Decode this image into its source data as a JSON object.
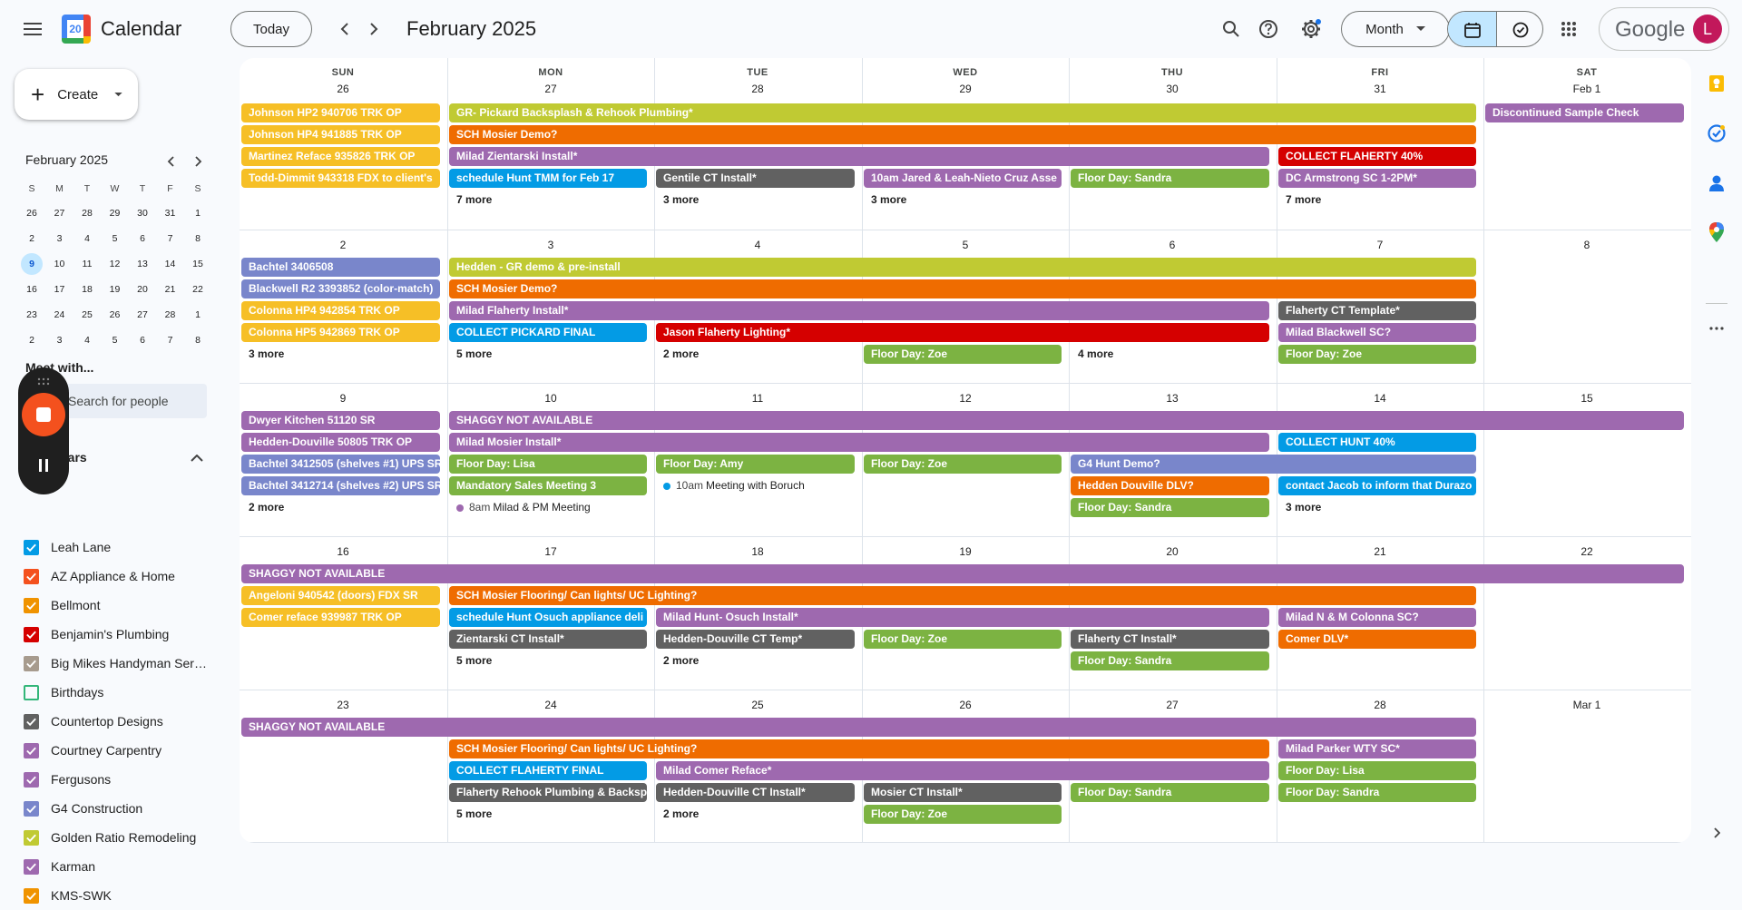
{
  "app": {
    "title": "Calendar",
    "logo_day": "20",
    "logo_colors": {
      "blue": "#4285f4",
      "red": "#ea4335",
      "yellow": "#fbbc04",
      "green": "#34a853"
    }
  },
  "header": {
    "today_label": "Today",
    "month_title": "February 2025",
    "view_label": "Month",
    "google_label": "Google",
    "avatar_letter": "L",
    "avatar_color": "#c2185b"
  },
  "sidebar": {
    "create_label": "Create",
    "mini_title": "February 2025",
    "mini_dow": [
      "S",
      "M",
      "T",
      "W",
      "T",
      "F",
      "S"
    ],
    "mini_weeks": [
      [
        "26",
        "27",
        "28",
        "29",
        "30",
        "31",
        "1"
      ],
      [
        "2",
        "3",
        "4",
        "5",
        "6",
        "7",
        "8"
      ],
      [
        "9",
        "10",
        "11",
        "12",
        "13",
        "14",
        "15"
      ],
      [
        "16",
        "17",
        "18",
        "19",
        "20",
        "21",
        "22"
      ],
      [
        "23",
        "24",
        "25",
        "26",
        "27",
        "28",
        "1"
      ],
      [
        "2",
        "3",
        "4",
        "5",
        "6",
        "7",
        "8"
      ]
    ],
    "mini_today": "9",
    "meet_title": "Meet with...",
    "search_people_placeholder": "Search for people",
    "calendars_title": "Calendars",
    "calendars": [
      {
        "name": "Leah Lane",
        "color": "#039be5",
        "checked": true
      },
      {
        "name": "AZ Appliance & Home",
        "color": "#f4511e",
        "checked": true
      },
      {
        "name": "Bellmont",
        "color": "#f09300",
        "checked": true
      },
      {
        "name": "Benjamin's Plumbing",
        "color": "#d50000",
        "checked": true
      },
      {
        "name": "Big Mikes Handyman Serv...",
        "color": "#a79b8e",
        "checked": true
      },
      {
        "name": "Birthdays",
        "color": "#33b679",
        "checked": false
      },
      {
        "name": "Countertop Designs",
        "color": "#616161",
        "checked": true
      },
      {
        "name": "Courtney Carpentry",
        "color": "#9e69af",
        "checked": true
      },
      {
        "name": "Fergusons",
        "color": "#9e69af",
        "checked": true
      },
      {
        "name": "G4 Construction",
        "color": "#7986cb",
        "checked": true
      },
      {
        "name": "Golden Ratio Remodeling",
        "color": "#c0ca33",
        "checked": true
      },
      {
        "name": "Karman",
        "color": "#9e69af",
        "checked": true
      },
      {
        "name": "KMS-SWK",
        "color": "#f09300",
        "checked": true
      }
    ]
  },
  "grid": {
    "dow": [
      "SUN",
      "MON",
      "TUE",
      "WED",
      "THU",
      "FRI",
      "SAT"
    ],
    "weeks": [
      {
        "dates": [
          "26",
          "27",
          "28",
          "29",
          "30",
          "31",
          "Feb 1"
        ],
        "events": [
          {
            "col": 0,
            "span": 1,
            "row": 0,
            "text": "Johnson HP2 940706 TRK OP",
            "color": "#f6bf26"
          },
          {
            "col": 1,
            "span": 5,
            "row": 0,
            "text": "GR- Pickard Backsplash & Rehook Plumbing*",
            "color": "#c0ca33"
          },
          {
            "col": 6,
            "span": 1,
            "row": 0,
            "text": "Discontinued Sample Check",
            "color": "#9e69af"
          },
          {
            "col": 0,
            "span": 1,
            "row": 1,
            "text": "Johnson HP4 941885 TRK OP",
            "color": "#f6bf26"
          },
          {
            "col": 1,
            "span": 5,
            "row": 1,
            "text": "SCH Mosier Demo?",
            "color": "#ef6c00"
          },
          {
            "col": 0,
            "span": 1,
            "row": 2,
            "text": "Martinez Reface 935826 TRK OP",
            "color": "#f6bf26"
          },
          {
            "col": 1,
            "span": 4,
            "row": 2,
            "text": "Milad Zientarski Install*",
            "color": "#9e69af"
          },
          {
            "col": 5,
            "span": 1,
            "row": 2,
            "text": "COLLECT FLAHERTY 40%",
            "color": "#d50000"
          },
          {
            "col": 0,
            "span": 1,
            "row": 3,
            "text": "Todd-Dimmit 943318 FDX to client's",
            "color": "#f6bf26"
          },
          {
            "col": 1,
            "span": 1,
            "row": 3,
            "text": "schedule Hunt TMM for Feb 17",
            "color": "#039be5"
          },
          {
            "col": 2,
            "span": 1,
            "row": 3,
            "text": "Gentile CT Install*",
            "color": "#616161"
          },
          {
            "col": 3,
            "span": 1,
            "row": 3,
            "text": "10am Jared & Leah-Nieto Cruz Asse",
            "color": "#9e69af"
          },
          {
            "col": 4,
            "span": 1,
            "row": 3,
            "text": "Floor Day: Sandra",
            "color": "#7cb342"
          },
          {
            "col": 5,
            "span": 1,
            "row": 3,
            "text": "DC Armstrong SC 1-2PM*",
            "color": "#9e69af"
          }
        ],
        "more": [
          {
            "col": 1,
            "row": 4,
            "text": "7 more"
          },
          {
            "col": 2,
            "row": 4,
            "text": "3 more"
          },
          {
            "col": 3,
            "row": 4,
            "text": "3 more"
          },
          {
            "col": 5,
            "row": 4,
            "text": "7 more"
          }
        ]
      },
      {
        "dates": [
          "2",
          "3",
          "4",
          "5",
          "6",
          "7",
          "8"
        ],
        "events": [
          {
            "col": 0,
            "span": 1,
            "row": 0,
            "text": "Bachtel 3406508",
            "color": "#7986cb"
          },
          {
            "col": 1,
            "span": 5,
            "row": 0,
            "text": "Hedden - GR demo & pre-install",
            "color": "#c0ca33"
          },
          {
            "col": 0,
            "span": 1,
            "row": 1,
            "text": "Blackwell R2 3393852 (color-match)",
            "color": "#7986cb"
          },
          {
            "col": 1,
            "span": 5,
            "row": 1,
            "text": "SCH Mosier Demo?",
            "color": "#ef6c00"
          },
          {
            "col": 0,
            "span": 1,
            "row": 2,
            "text": "Colonna HP4 942854 TRK OP",
            "color": "#f6bf26"
          },
          {
            "col": 1,
            "span": 4,
            "row": 2,
            "text": "Milad Flaherty Install*",
            "color": "#9e69af"
          },
          {
            "col": 5,
            "span": 1,
            "row": 2,
            "text": "Flaherty CT Template*",
            "color": "#616161"
          },
          {
            "col": 0,
            "span": 1,
            "row": 3,
            "text": "Colonna HP5 942869 TRK OP",
            "color": "#f6bf26"
          },
          {
            "col": 1,
            "span": 1,
            "row": 3,
            "text": "COLLECT PICKARD FINAL",
            "color": "#039be5"
          },
          {
            "col": 2,
            "span": 3,
            "row": 3,
            "text": "Jason Flaherty Lighting*",
            "color": "#d50000"
          },
          {
            "col": 5,
            "span": 1,
            "row": 3,
            "text": "Milad Blackwell SC?",
            "color": "#9e69af"
          },
          {
            "col": 3,
            "span": 1,
            "row": 4,
            "text": "Floor Day: Zoe",
            "color": "#7cb342"
          },
          {
            "col": 5,
            "span": 1,
            "row": 4,
            "text": "Floor Day: Zoe",
            "color": "#7cb342"
          }
        ],
        "more": [
          {
            "col": 0,
            "row": 4,
            "text": "3 more"
          },
          {
            "col": 1,
            "row": 4,
            "text": "5 more"
          },
          {
            "col": 2,
            "row": 4,
            "text": "2 more"
          },
          {
            "col": 4,
            "row": 4,
            "text": "4 more"
          }
        ]
      },
      {
        "dates": [
          "9",
          "10",
          "11",
          "12",
          "13",
          "14",
          "15"
        ],
        "events": [
          {
            "col": 0,
            "span": 1,
            "row": 0,
            "text": "Dwyer Kitchen 51120 SR",
            "color": "#9e69af"
          },
          {
            "col": 1,
            "span": 6,
            "row": 0,
            "text": "SHAGGY NOT AVAILABLE",
            "color": "#9e69af"
          },
          {
            "col": 0,
            "span": 1,
            "row": 1,
            "text": "Hedden-Douville 50805 TRK OP",
            "color": "#9e69af"
          },
          {
            "col": 1,
            "span": 4,
            "row": 1,
            "text": "Milad Mosier Install*",
            "color": "#9e69af"
          },
          {
            "col": 5,
            "span": 1,
            "row": 1,
            "text": "COLLECT HUNT 40%",
            "color": "#039be5"
          },
          {
            "col": 0,
            "span": 1,
            "row": 2,
            "text": "Bachtel 3412505 (shelves #1) UPS SR",
            "color": "#7986cb"
          },
          {
            "col": 1,
            "span": 1,
            "row": 2,
            "text": "Floor Day: Lisa",
            "color": "#7cb342"
          },
          {
            "col": 2,
            "span": 1,
            "row": 2,
            "text": "Floor Day: Amy",
            "color": "#7cb342"
          },
          {
            "col": 3,
            "span": 1,
            "row": 2,
            "text": "Floor Day: Zoe",
            "color": "#7cb342"
          },
          {
            "col": 4,
            "span": 2,
            "row": 2,
            "text": "G4 Hunt Demo?",
            "color": "#7986cb"
          },
          {
            "col": 0,
            "span": 1,
            "row": 3,
            "text": "Bachtel 3412714 (shelves #2) UPS SR",
            "color": "#7986cb"
          },
          {
            "col": 1,
            "span": 1,
            "row": 3,
            "text": "Mandatory Sales Meeting 3",
            "color": "#7cb342"
          },
          {
            "col": 4,
            "span": 1,
            "row": 3,
            "text": "Hedden Douville DLV?",
            "color": "#ef6c00"
          },
          {
            "col": 5,
            "span": 1,
            "row": 3,
            "text": "contact Jacob to inform that Durazo",
            "color": "#039be5"
          },
          {
            "col": 4,
            "span": 1,
            "row": 4,
            "text": "Floor Day: Sandra",
            "color": "#7cb342"
          }
        ],
        "dots": [
          {
            "col": 2,
            "row": 3,
            "time": "10am",
            "text": "Meeting with Boruch",
            "color": "#039be5"
          },
          {
            "col": 1,
            "row": 4,
            "time": "8am",
            "text": "Milad & PM Meeting",
            "color": "#9e69af"
          }
        ],
        "more": [
          {
            "col": 0,
            "row": 4,
            "text": "2 more"
          },
          {
            "col": 5,
            "row": 4,
            "text": "3 more"
          }
        ]
      },
      {
        "dates": [
          "16",
          "17",
          "18",
          "19",
          "20",
          "21",
          "22"
        ],
        "events": [
          {
            "col": 0,
            "span": 7,
            "row": 0,
            "text": "SHAGGY NOT AVAILABLE",
            "color": "#9e69af"
          },
          {
            "col": 0,
            "span": 1,
            "row": 1,
            "text": "Angeloni 940542 (doors) FDX SR",
            "color": "#f6bf26"
          },
          {
            "col": 1,
            "span": 5,
            "row": 1,
            "text": "SCH Mosier Flooring/ Can lights/ UC Lighting?",
            "color": "#ef6c00"
          },
          {
            "col": 0,
            "span": 1,
            "row": 2,
            "text": "Comer reface 939987 TRK OP",
            "color": "#f6bf26"
          },
          {
            "col": 1,
            "span": 1,
            "row": 2,
            "text": "schedule Hunt Osuch appliance deli",
            "color": "#039be5"
          },
          {
            "col": 2,
            "span": 3,
            "row": 2,
            "text": "Milad Hunt- Osuch Install*",
            "color": "#9e69af"
          },
          {
            "col": 5,
            "span": 1,
            "row": 2,
            "text": "Milad N & M Colonna SC?",
            "color": "#9e69af"
          },
          {
            "col": 1,
            "span": 1,
            "row": 3,
            "text": "Zientarski CT Install*",
            "color": "#616161"
          },
          {
            "col": 2,
            "span": 1,
            "row": 3,
            "text": "Hedden-Douville CT Temp*",
            "color": "#616161"
          },
          {
            "col": 3,
            "span": 1,
            "row": 3,
            "text": "Floor Day: Zoe",
            "color": "#7cb342"
          },
          {
            "col": 4,
            "span": 1,
            "row": 3,
            "text": "Flaherty CT Install*",
            "color": "#616161"
          },
          {
            "col": 5,
            "span": 1,
            "row": 3,
            "text": "Comer DLV*",
            "color": "#ef6c00"
          },
          {
            "col": 4,
            "span": 1,
            "row": 4,
            "text": "Floor Day: Sandra",
            "color": "#7cb342"
          }
        ],
        "more": [
          {
            "col": 1,
            "row": 4,
            "text": "5 more"
          },
          {
            "col": 2,
            "row": 4,
            "text": "2 more"
          }
        ]
      },
      {
        "dates": [
          "23",
          "24",
          "25",
          "26",
          "27",
          "28",
          "Mar 1"
        ],
        "events": [
          {
            "col": 0,
            "span": 6,
            "row": 0,
            "text": "SHAGGY NOT AVAILABLE",
            "color": "#9e69af"
          },
          {
            "col": 1,
            "span": 4,
            "row": 1,
            "text": "SCH Mosier Flooring/ Can lights/ UC Lighting?",
            "color": "#ef6c00"
          },
          {
            "col": 5,
            "span": 1,
            "row": 1,
            "text": "Milad Parker WTY SC*",
            "color": "#9e69af"
          },
          {
            "col": 1,
            "span": 1,
            "row": 2,
            "text": "COLLECT FLAHERTY FINAL",
            "color": "#039be5"
          },
          {
            "col": 2,
            "span": 3,
            "row": 2,
            "text": "Milad Comer Reface*",
            "color": "#9e69af"
          },
          {
            "col": 5,
            "span": 1,
            "row": 2,
            "text": "Floor Day: Lisa",
            "color": "#7cb342"
          },
          {
            "col": 1,
            "span": 1,
            "row": 3,
            "text": "Flaherty Rehook Plumbing & Backsp",
            "color": "#616161"
          },
          {
            "col": 2,
            "span": 1,
            "row": 3,
            "text": "Hedden-Douville CT Install*",
            "color": "#616161"
          },
          {
            "col": 3,
            "span": 1,
            "row": 3,
            "text": "Mosier CT Install*",
            "color": "#616161"
          },
          {
            "col": 4,
            "span": 1,
            "row": 3,
            "text": "Floor Day: Sandra",
            "color": "#7cb342"
          },
          {
            "col": 5,
            "span": 1,
            "row": 3,
            "text": "Floor Day: Sandra",
            "color": "#7cb342"
          },
          {
            "col": 3,
            "span": 1,
            "row": 4,
            "text": "Floor Day: Zoe",
            "color": "#7cb342"
          }
        ],
        "more": [
          {
            "col": 1,
            "row": 4,
            "text": "5 more"
          },
          {
            "col": 2,
            "row": 4,
            "text": "2 more"
          }
        ]
      }
    ]
  }
}
